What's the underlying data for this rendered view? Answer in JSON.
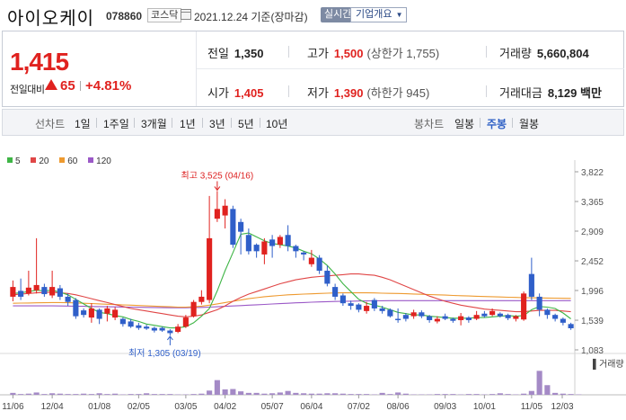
{
  "header": {
    "title": "아이오케이",
    "code": "078860",
    "market": "코스닥",
    "date": "2021.12.24 기준(장마감)",
    "realtime": "실시간",
    "info_button": "기업개요"
  },
  "summary": {
    "price": "1,415",
    "change_label": "전일대비",
    "change_abs": "65",
    "change_pct": "+4.81%",
    "prev_close_label": "전일",
    "prev_close": "1,350",
    "high_label": "고가",
    "high": "1,500",
    "upper_limit": "(상한가 1,755)",
    "volume_label": "거래량",
    "volume": "5,660,804",
    "open_label": "시가",
    "open": "1,405",
    "low_label": "저가",
    "low": "1,390",
    "lower_limit": "(하한가 945)",
    "amount_label": "거래대금",
    "amount": "8,129 백만"
  },
  "tabs": {
    "line_label": "선차트",
    "line_tabs": [
      "1일",
      "1주일",
      "3개월",
      "1년",
      "3년",
      "5년",
      "10년"
    ],
    "candle_label": "봉차트",
    "candle_tabs": [
      "일봉",
      "주봉",
      "월봉"
    ],
    "active_tab": "주봉"
  },
  "colors": {
    "up": "#e0221f",
    "down": "#2f5fc9",
    "ma5": "#3fb546",
    "ma20": "#e04646",
    "ma60": "#ee9a30",
    "ma120": "#9b59c7",
    "volume": "#a48ac6"
  },
  "chart_data": {
    "type": "candlestick",
    "period": "weekly",
    "legend": [
      "5",
      "20",
      "60",
      "120"
    ],
    "y_ticks": [
      3822,
      3365,
      2909,
      2452,
      1996,
      1539,
      1083
    ],
    "y_range": [
      1083,
      3822
    ],
    "x_ticks": [
      "11/06",
      "12/04",
      "01/08",
      "02/05",
      "03/05",
      "04/02",
      "05/07",
      "06/04",
      "07/02",
      "08/06",
      "09/03",
      "10/01",
      "11/05",
      "12/03"
    ],
    "high_annotation": "최고 3,525 (04/16)",
    "low_annotation": "최저 1,305 (03/19)",
    "volume_label": "거래량",
    "candles": [
      {
        "o": 1900,
        "c": 2050,
        "h": 2150,
        "l": 1830
      },
      {
        "o": 1990,
        "c": 1900,
        "h": 2180,
        "l": 1850
      },
      {
        "o": 1950,
        "c": 2040,
        "h": 2300,
        "l": 1920
      },
      {
        "o": 2000,
        "c": 2080,
        "h": 2800,
        "l": 1950
      },
      {
        "o": 2050,
        "c": 1940,
        "h": 2100,
        "l": 1900
      },
      {
        "o": 1920,
        "c": 2050,
        "h": 2300,
        "l": 1880
      },
      {
        "o": 2030,
        "c": 1900,
        "h": 2080,
        "l": 1850
      },
      {
        "o": 1900,
        "c": 1820,
        "h": 1950,
        "l": 1760
      },
      {
        "o": 1850,
        "c": 1600,
        "h": 1880,
        "l": 1560
      },
      {
        "o": 1690,
        "c": 1620,
        "h": 1720,
        "l": 1580
      },
      {
        "o": 1580,
        "c": 1720,
        "h": 1800,
        "l": 1500
      },
      {
        "o": 1700,
        "c": 1560,
        "h": 1720,
        "l": 1480
      },
      {
        "o": 1640,
        "c": 1720,
        "h": 1760,
        "l": 1520
      },
      {
        "o": 1580,
        "c": 1700,
        "h": 1740,
        "l": 1540
      },
      {
        "o": 1560,
        "c": 1480,
        "h": 1580,
        "l": 1440
      },
      {
        "o": 1520,
        "c": 1440,
        "h": 1560,
        "l": 1420
      },
      {
        "o": 1460,
        "c": 1420,
        "h": 1500,
        "l": 1390
      },
      {
        "o": 1440,
        "c": 1410,
        "h": 1470,
        "l": 1390
      },
      {
        "o": 1420,
        "c": 1380,
        "h": 1440,
        "l": 1350
      },
      {
        "o": 1420,
        "c": 1380,
        "h": 1440,
        "l": 1360
      },
      {
        "o": 1380,
        "c": 1340,
        "h": 1400,
        "l": 1305
      },
      {
        "o": 1360,
        "c": 1440,
        "h": 1480,
        "l": 1340
      },
      {
        "o": 1440,
        "c": 1580,
        "h": 1620,
        "l": 1420
      },
      {
        "o": 1600,
        "c": 1820,
        "h": 1850,
        "l": 1580
      },
      {
        "o": 1820,
        "c": 1900,
        "h": 2000,
        "l": 1780
      },
      {
        "o": 1850,
        "c": 2800,
        "h": 3450,
        "l": 1800
      },
      {
        "o": 3100,
        "c": 3250,
        "h": 3525,
        "l": 3050
      },
      {
        "o": 3150,
        "c": 3300,
        "h": 3400,
        "l": 2950
      },
      {
        "o": 3250,
        "c": 2700,
        "h": 3300,
        "l": 2650
      },
      {
        "o": 3050,
        "c": 2900,
        "h": 3100,
        "l": 2550
      },
      {
        "o": 2850,
        "c": 2600,
        "h": 2950,
        "l": 2550
      },
      {
        "o": 2700,
        "c": 2600,
        "h": 2720,
        "l": 2500
      },
      {
        "o": 2550,
        "c": 2750,
        "h": 2800,
        "l": 2400
      },
      {
        "o": 2780,
        "c": 2680,
        "h": 2850,
        "l": 2500
      },
      {
        "o": 2700,
        "c": 2820,
        "h": 2850,
        "l": 2650
      },
      {
        "o": 2850,
        "c": 2680,
        "h": 3000,
        "l": 2600
      },
      {
        "o": 2680,
        "c": 2600,
        "h": 2700,
        "l": 2500
      },
      {
        "o": 2580,
        "c": 2550,
        "h": 2600,
        "l": 2460
      },
      {
        "o": 2400,
        "c": 2500,
        "h": 2620,
        "l": 2360
      },
      {
        "o": 2500,
        "c": 2300,
        "h": 2540,
        "l": 2250
      },
      {
        "o": 2300,
        "c": 2100,
        "h": 2380,
        "l": 2060
      },
      {
        "o": 2050,
        "c": 1900,
        "h": 2100,
        "l": 1850
      },
      {
        "o": 1920,
        "c": 1800,
        "h": 1950,
        "l": 1760
      },
      {
        "o": 1800,
        "c": 1760,
        "h": 1840,
        "l": 1700
      },
      {
        "o": 1780,
        "c": 1700,
        "h": 1800,
        "l": 1660
      },
      {
        "o": 1680,
        "c": 1760,
        "h": 1820,
        "l": 1640
      },
      {
        "o": 1850,
        "c": 1720,
        "h": 1880,
        "l": 1680
      },
      {
        "o": 1720,
        "c": 1680,
        "h": 1760,
        "l": 1640
      },
      {
        "o": 1700,
        "c": 1600,
        "h": 1720,
        "l": 1580
      },
      {
        "o": 1560,
        "c": 1540,
        "h": 1720,
        "l": 1500
      },
      {
        "o": 1620,
        "c": 1560,
        "h": 1650,
        "l": 1520
      },
      {
        "o": 1600,
        "c": 1660,
        "h": 1700,
        "l": 1560
      },
      {
        "o": 1660,
        "c": 1600,
        "h": 1690,
        "l": 1570
      },
      {
        "o": 1600,
        "c": 1540,
        "h": 1620,
        "l": 1500
      },
      {
        "o": 1520,
        "c": 1560,
        "h": 1600,
        "l": 1490
      },
      {
        "o": 1600,
        "c": 1560,
        "h": 1640,
        "l": 1540
      },
      {
        "o": 1560,
        "c": 1530,
        "h": 1580,
        "l": 1500
      },
      {
        "o": 1540,
        "c": 1600,
        "h": 1650,
        "l": 1460
      },
      {
        "o": 1580,
        "c": 1540,
        "h": 1600,
        "l": 1500
      },
      {
        "o": 1560,
        "c": 1620,
        "h": 1680,
        "l": 1540
      },
      {
        "o": 1640,
        "c": 1600,
        "h": 1680,
        "l": 1580
      },
      {
        "o": 1620,
        "c": 1680,
        "h": 1720,
        "l": 1600
      },
      {
        "o": 1640,
        "c": 1600,
        "h": 1660,
        "l": 1580
      },
      {
        "o": 1620,
        "c": 1570,
        "h": 1640,
        "l": 1540
      },
      {
        "o": 1560,
        "c": 1600,
        "h": 1620,
        "l": 1520
      },
      {
        "o": 1550,
        "c": 1950,
        "h": 1980,
        "l": 1530
      },
      {
        "o": 2250,
        "c": 1900,
        "h": 2500,
        "l": 1850
      },
      {
        "o": 1900,
        "c": 1700,
        "h": 1950,
        "l": 1600
      },
      {
        "o": 1700,
        "c": 1620,
        "h": 1720,
        "l": 1560
      },
      {
        "o": 1620,
        "c": 1560,
        "h": 1640,
        "l": 1520
      },
      {
        "o": 1560,
        "c": 1500,
        "h": 1580,
        "l": 1460
      },
      {
        "o": 1480,
        "c": 1415,
        "h": 1500,
        "l": 1390
      }
    ],
    "ma5": [
      1950,
      1960,
      1980,
      2000,
      1990,
      2000,
      1970,
      1930,
      1860,
      1790,
      1720,
      1660,
      1640,
      1610,
      1590,
      1550,
      1520,
      1480,
      1460,
      1440,
      1420,
      1420,
      1440,
      1500,
      1600,
      1720,
      1990,
      2300,
      2580,
      2860,
      2880,
      2820,
      2760,
      2720,
      2700,
      2680,
      2650,
      2600,
      2560,
      2480,
      2380,
      2250,
      2100,
      1980,
      1860,
      1800,
      1770,
      1740,
      1700,
      1660,
      1640,
      1620,
      1620,
      1600,
      1590,
      1580,
      1570,
      1570,
      1570,
      1580,
      1580,
      1590,
      1600,
      1610,
      1600,
      1610,
      1700,
      1750,
      1740,
      1720,
      1650,
      1560
    ],
    "ma20": [
      1930,
      1940,
      1950,
      1960,
      1965,
      1970,
      1960,
      1950,
      1930,
      1900,
      1870,
      1840,
      1810,
      1780,
      1750,
      1720,
      1700,
      1680,
      1660,
      1640,
      1620,
      1600,
      1590,
      1600,
      1620,
      1660,
      1700,
      1760,
      1830,
      1890,
      1940,
      1980,
      2020,
      2060,
      2100,
      2130,
      2160,
      2180,
      2200,
      2210,
      2220,
      2230,
      2240,
      2250,
      2250,
      2240,
      2230,
      2200,
      2160,
      2110,
      2060,
      2010,
      1960,
      1910,
      1870,
      1830,
      1800,
      1770,
      1750,
      1730,
      1710,
      1700,
      1690,
      1680,
      1670,
      1670,
      1680,
      1690,
      1690,
      1690,
      1680,
      1670
    ],
    "ma60": [
      1800,
      1802,
      1804,
      1806,
      1808,
      1810,
      1810,
      1808,
      1805,
      1800,
      1795,
      1790,
      1785,
      1780,
      1775,
      1770,
      1765,
      1760,
      1755,
      1750,
      1745,
      1740,
      1740,
      1745,
      1755,
      1770,
      1790,
      1810,
      1830,
      1850,
      1870,
      1885,
      1900,
      1910,
      1920,
      1930,
      1935,
      1940,
      1945,
      1950,
      1955,
      1958,
      1960,
      1960,
      1960,
      1960,
      1958,
      1955,
      1952,
      1950,
      1946,
      1942,
      1938,
      1934,
      1930,
      1925,
      1920,
      1916,
      1912,
      1908,
      1904,
      1900,
      1896,
      1892,
      1890,
      1886,
      1884,
      1882,
      1880,
      1878,
      1876,
      1874
    ],
    "ma120": [
      1760,
      1760,
      1760,
      1760,
      1760,
      1760,
      1758,
      1756,
      1754,
      1752,
      1750,
      1748,
      1746,
      1744,
      1742,
      1740,
      1738,
      1736,
      1734,
      1732,
      1730,
      1730,
      1731,
      1733,
      1736,
      1740,
      1746,
      1752,
      1758,
      1764,
      1770,
      1776,
      1782,
      1788,
      1794,
      1800,
      1806,
      1811,
      1816,
      1820,
      1824,
      1827,
      1830,
      1832,
      1834,
      1836,
      1837,
      1838,
      1839,
      1840,
      1840,
      1840,
      1840,
      1840,
      1840,
      1840,
      1840,
      1840,
      1840,
      1840,
      1840,
      1840,
      1840,
      1840,
      1840,
      1840,
      1840,
      1840,
      1840,
      1840,
      1840,
      1840
    ],
    "volume": [
      0.05,
      0.02,
      0.03,
      0.06,
      0.02,
      0.04,
      0.03,
      0.02,
      0.02,
      0.03,
      0.02,
      0.04,
      0.02,
      0.03,
      0.01,
      0.02,
      0.02,
      0.04,
      0.02,
      0.02,
      0.02,
      0.01,
      0.01,
      0.02,
      0.03,
      0.11,
      0.38,
      0.14,
      0.15,
      0.09,
      0.05,
      0.05,
      0.03,
      0.04,
      0.06,
      0.1,
      0.05,
      0.04,
      0.03,
      0.03,
      0.04,
      0.04,
      0.03,
      0.02,
      0.02,
      0.02,
      0.01,
      0.05,
      0.02,
      0.06,
      0.03,
      0.01,
      0.01,
      0.01,
      0.02,
      0.02,
      0.02,
      0.01,
      0.02,
      0.02,
      0.01,
      0.02,
      0.04,
      0.02,
      0.01,
      0.03,
      0.1,
      0.62,
      0.25,
      0.05,
      0.03,
      0.02,
      0.01
    ]
  }
}
